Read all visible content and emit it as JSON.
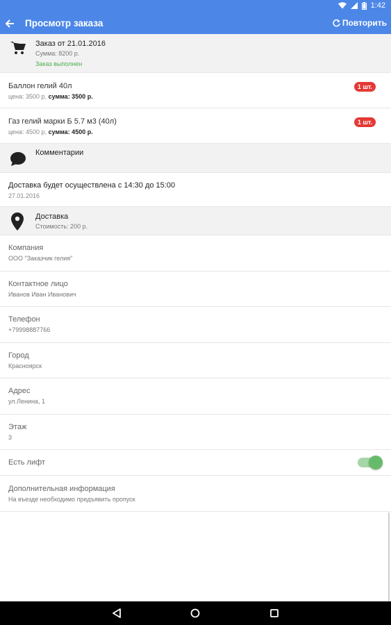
{
  "status_bar": {
    "time": "1:42"
  },
  "toolbar": {
    "title": "Просмотр заказа",
    "repeat_label": "Повторить",
    "color": "#4c87e8"
  },
  "order": {
    "title": "Заказ от 21.01.2016",
    "sum": "Сумма: 8200 р.",
    "status": "Заказ выполнен",
    "status_color": "#4caf50",
    "icon": "cart-icon"
  },
  "items": [
    {
      "name": "Баллон гелий 40л",
      "price_label": "цена: 3500 р,",
      "sum_label": "сумма: 3500 р.",
      "qty": "1 шт."
    },
    {
      "name": "Газ гелий марки Б 5.7 м3 (40л)",
      "price_label": "цена: 4500 р,",
      "sum_label": "сумма: 4500 р.",
      "qty": "1 шт."
    }
  ],
  "comments": {
    "label": "Комментарии",
    "icon": "comment-icon"
  },
  "delivery_info": {
    "line1": "Доставка будет осуществлена с 14:30 до 15:00",
    "line2": "27.01.2016"
  },
  "delivery": {
    "title": "Доставка",
    "cost": "Стоимость: 200 р.",
    "icon": "location-pin-icon"
  },
  "fields": [
    {
      "label": "Компания",
      "value": "ООО \"Заказчик гелия\""
    },
    {
      "label": "Контактное лицо",
      "value": "Иванов Иван Иванович"
    },
    {
      "label": "Телефон",
      "value": "+79998887766"
    },
    {
      "label": "Город",
      "value": "Красноярск"
    },
    {
      "label": "Адрес",
      "value": "ул.Ленина, 1"
    },
    {
      "label": "Этаж",
      "value": "3"
    }
  ],
  "lift": {
    "label": "Есть лифт",
    "enabled": true,
    "toggle_color": "#66bb6a"
  },
  "extra": {
    "label": "Дополнительная информация",
    "value": "На въезде необходимо предъявить пропуск"
  }
}
